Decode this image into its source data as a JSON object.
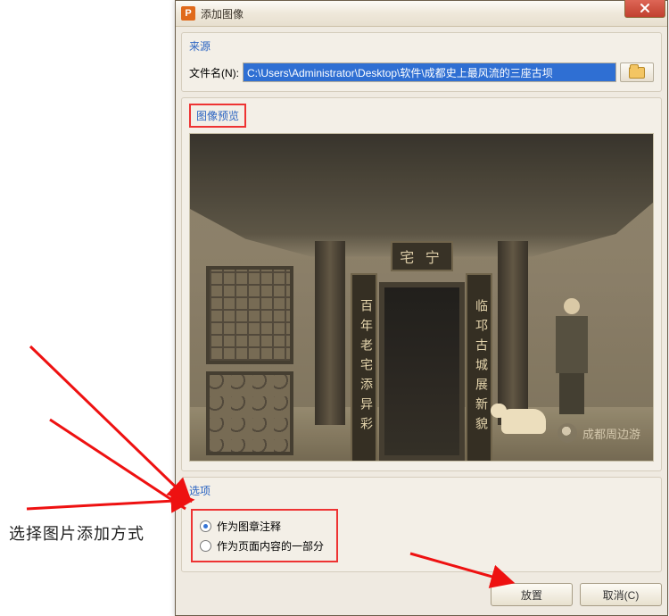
{
  "annotation": {
    "left_text": "选择图片添加方式"
  },
  "dialog": {
    "title": "添加图像",
    "source": {
      "legend": "来源",
      "file_label": "文件名(N):",
      "file_value": "C:\\Users\\Administrator\\Desktop\\软件\\成都史上最风流的三座古坝"
    },
    "preview": {
      "legend": "图像预览",
      "plaque": "宅 宁",
      "scroll_left": "百年老宅添异彩",
      "scroll_right": "临邛古城展新貌",
      "watermark": "成都周边游"
    },
    "options": {
      "legend": "选项",
      "radio1": "作为图章注释",
      "radio2": "作为页面内容的一部分"
    },
    "buttons": {
      "place": "放置",
      "cancel": "取消(C)"
    }
  }
}
